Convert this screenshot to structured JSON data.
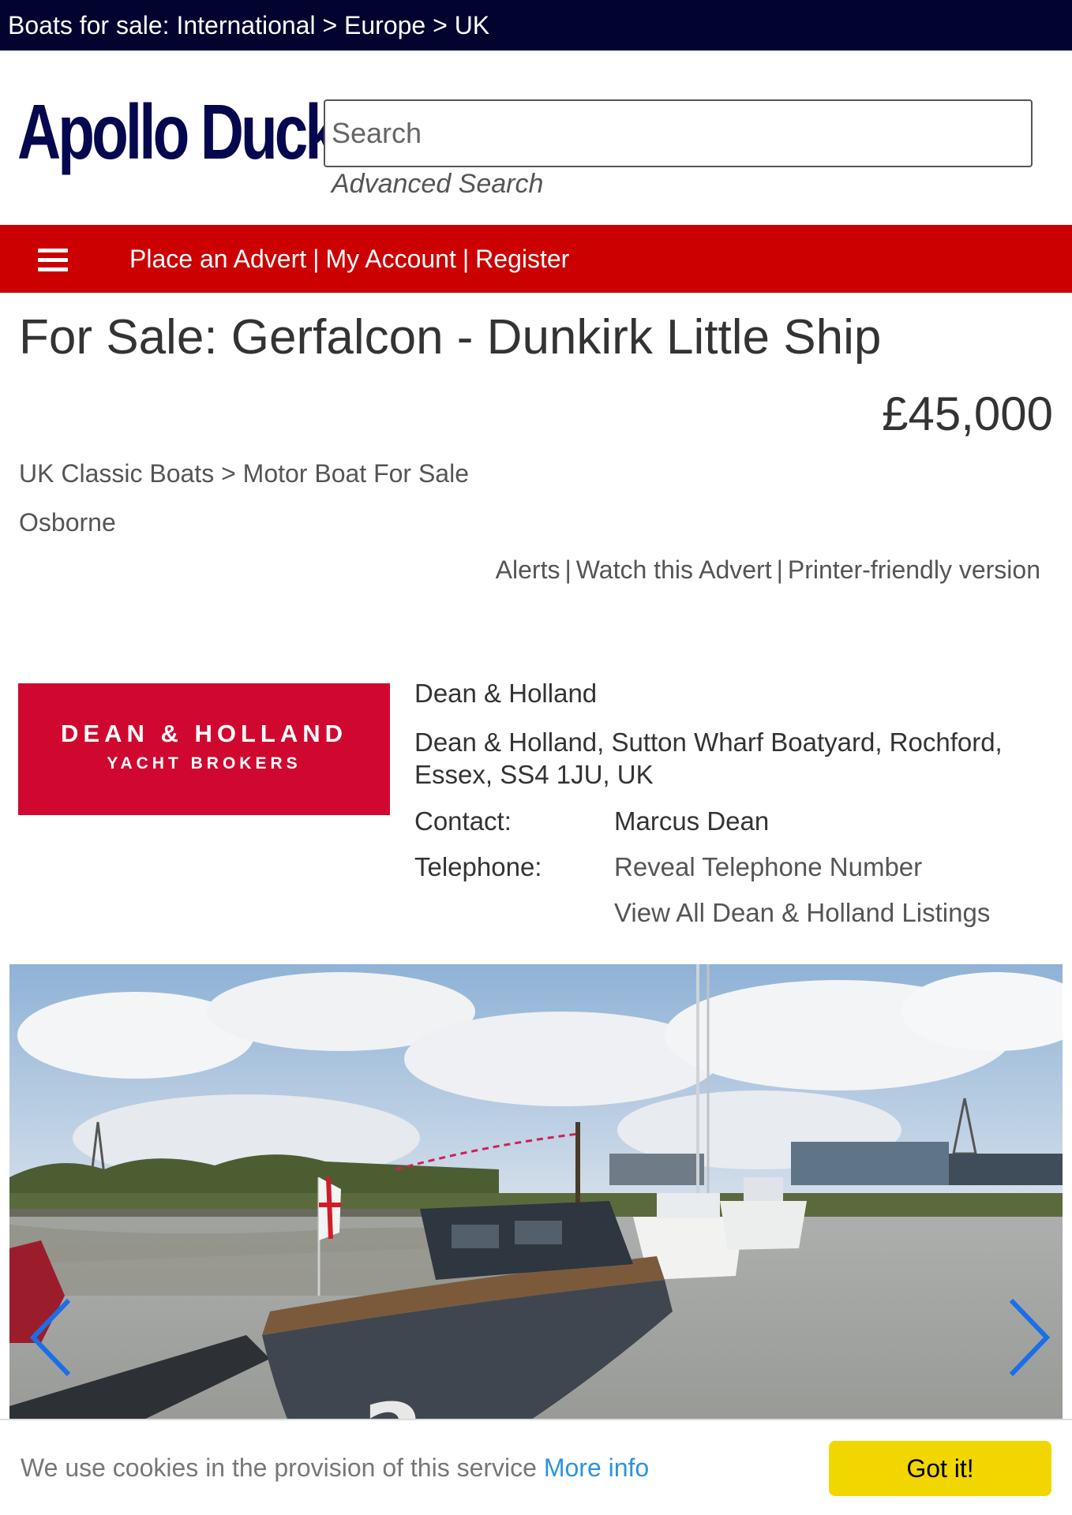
{
  "breadcrumb": {
    "text": "Boats for sale: International > Europe > UK"
  },
  "header": {
    "logo_text": "Apollo Duck",
    "search_placeholder": "Search",
    "advanced_search": "Advanced Search"
  },
  "nav": {
    "menu_icon": "hamburger-icon",
    "items": [
      {
        "label": "Place an Advert"
      },
      {
        "label": "My Account"
      },
      {
        "label": "Register"
      }
    ],
    "separator": "|"
  },
  "listing": {
    "title": "For Sale: Gerfalcon - Dunkirk Little Ship",
    "price": "£45,000",
    "category": "UK Classic Boats > Motor Boat For Sale",
    "builder": "Osborne",
    "actions": [
      {
        "label": "Alerts"
      },
      {
        "label": "Watch this Advert"
      },
      {
        "label": "Printer-friendly version"
      }
    ],
    "actions_separator": "|"
  },
  "dealer": {
    "logo_line1": "DEAN & HOLLAND",
    "logo_line2": "YACHT BROKERS",
    "name": "Dean & Holland",
    "address": "Dean & Holland, Sutton Wharf Boatyard, Rochford, Essex, SS4 1JU, UK",
    "contact_label": "Contact:",
    "contact_value": "Marcus Dean",
    "telephone_label": "Telephone:",
    "telephone_value": "Reveal Telephone Number",
    "listings_link": "View All Dean & Holland Listings",
    "brand_color": "#d0082f"
  },
  "gallery": {
    "prev_icon": "chevron-left-icon",
    "next_icon": "chevron-right-icon",
    "arrow_color": "#1a6fe8"
  },
  "cookie": {
    "text": "We use cookies in the provision of this service",
    "more_info": "More info",
    "button": "Got it!",
    "button_color": "#f1d600"
  },
  "colors": {
    "top_bar": "#02032e",
    "nav_bar": "#cc0000",
    "logo": "#06084f"
  }
}
